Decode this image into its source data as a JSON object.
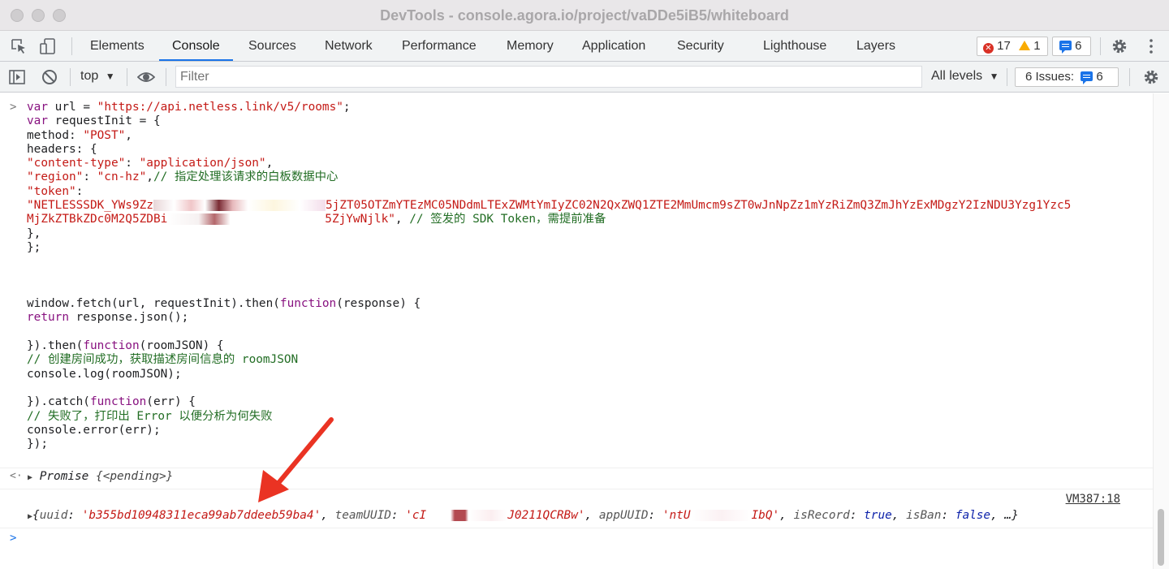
{
  "window": {
    "title": "DevTools - console.agora.io/project/vaDDe5iB5/whiteboard"
  },
  "tabs": [
    {
      "label": "Elements"
    },
    {
      "label": "Console"
    },
    {
      "label": "Sources"
    },
    {
      "label": "Network"
    },
    {
      "label": "Performance"
    },
    {
      "label": "Memory"
    },
    {
      "label": "Application"
    },
    {
      "label": "Security"
    },
    {
      "label": "Lighthouse"
    },
    {
      "label": "Layers"
    }
  ],
  "status": {
    "errors": "17",
    "warnings": "1",
    "messages": "6"
  },
  "filterbar": {
    "context": "top",
    "filter_placeholder": "Filter",
    "levels": "All levels",
    "issues_label": "6 Issues:",
    "issues_count": "6"
  },
  "console": {
    "lines": {
      "l1a": "var",
      "l1b": " url = ",
      "l1c": "\"https://api.netless.link/v5/rooms\"",
      "l1d": ";",
      "l2a": "var",
      "l2b": " requestInit = {",
      "l3a": "method: ",
      "l3b": "\"POST\"",
      "l3c": ",",
      "l4": "headers: {",
      "l5a": "\"content-type\"",
      "l5b": ": ",
      "l5c": "\"application/json\"",
      "l5d": ",",
      "l6a": "\"region\"",
      "l6b": ": ",
      "l6c": "\"cn-hz\"",
      "l6d": ",",
      "l6e": "// 指定处理该请求的白板数据中心",
      "l7a": "\"token\"",
      "l7b": ":",
      "l8a": "\"NETLESSSDK_YWs9Zz",
      "l8b": "5jZT05OTZmYTEzMC05NDdmLTExZWMtYmIyZC02N2QxZWQ1ZTE2MmUmcm9sZT0wJnNpZz1mYzRiZmQ3ZmJhYzExMDgzY2IzNDU3Yzg1Yzc5",
      "l9a": "MjZkZTBkZDc0M2Q5ZDBi",
      "l9b": "5ZjYwNjlk\"",
      "l9c": ", ",
      "l9d": "// 签发的 SDK Token，需提前准备",
      "l10": "},",
      "l11": "};",
      "l12a": "window.fetch(url, requestInit).then(",
      "l12b": "function",
      "l12c": "(response) {",
      "l13a": "return",
      "l13b": " response.json();",
      "l14a": "}).then(",
      "l14b": "function",
      "l14c": "(roomJSON) {",
      "l15": "// 创建房间成功，获取描述房间信息的 roomJSON",
      "l16": "console.log(roomJSON);",
      "l17a": "}).catch(",
      "l17b": "function",
      "l17c": "(err) {",
      "l18": "// 失败了，打印出 Error 以便分析为何失败",
      "l19": "console.error(err);",
      "l20": "});"
    },
    "promise": {
      "label": "Promise",
      "state": "{<pending>}"
    },
    "source_link": "VM387:18",
    "result": {
      "open": "{",
      "k1": "uuid",
      "v1": "'b355bd10948311eca99ab7ddeeb59ba4'",
      "k2": "teamUUID",
      "v2a": "'cI",
      "v2b": "J0211QCRBw'",
      "k3": "appUUID",
      "v3a": "'ntU",
      "v3b": "IbQ'",
      "k4": "isRecord",
      "v4": "true",
      "k5": "isBan",
      "v5": "false",
      "tail": ", …}"
    }
  },
  "colors": {
    "accent": "#1a73e8",
    "error": "#d93025",
    "warning": "#f9ab00",
    "annotation_arrow": "#ea3323"
  },
  "icons": [
    "inspect-icon",
    "device-toolbar-icon",
    "settings-icon",
    "more-options-icon",
    "sidebar-toggle-icon",
    "clear-console-icon",
    "eye-icon",
    "dropdown-arrow-icon"
  ]
}
